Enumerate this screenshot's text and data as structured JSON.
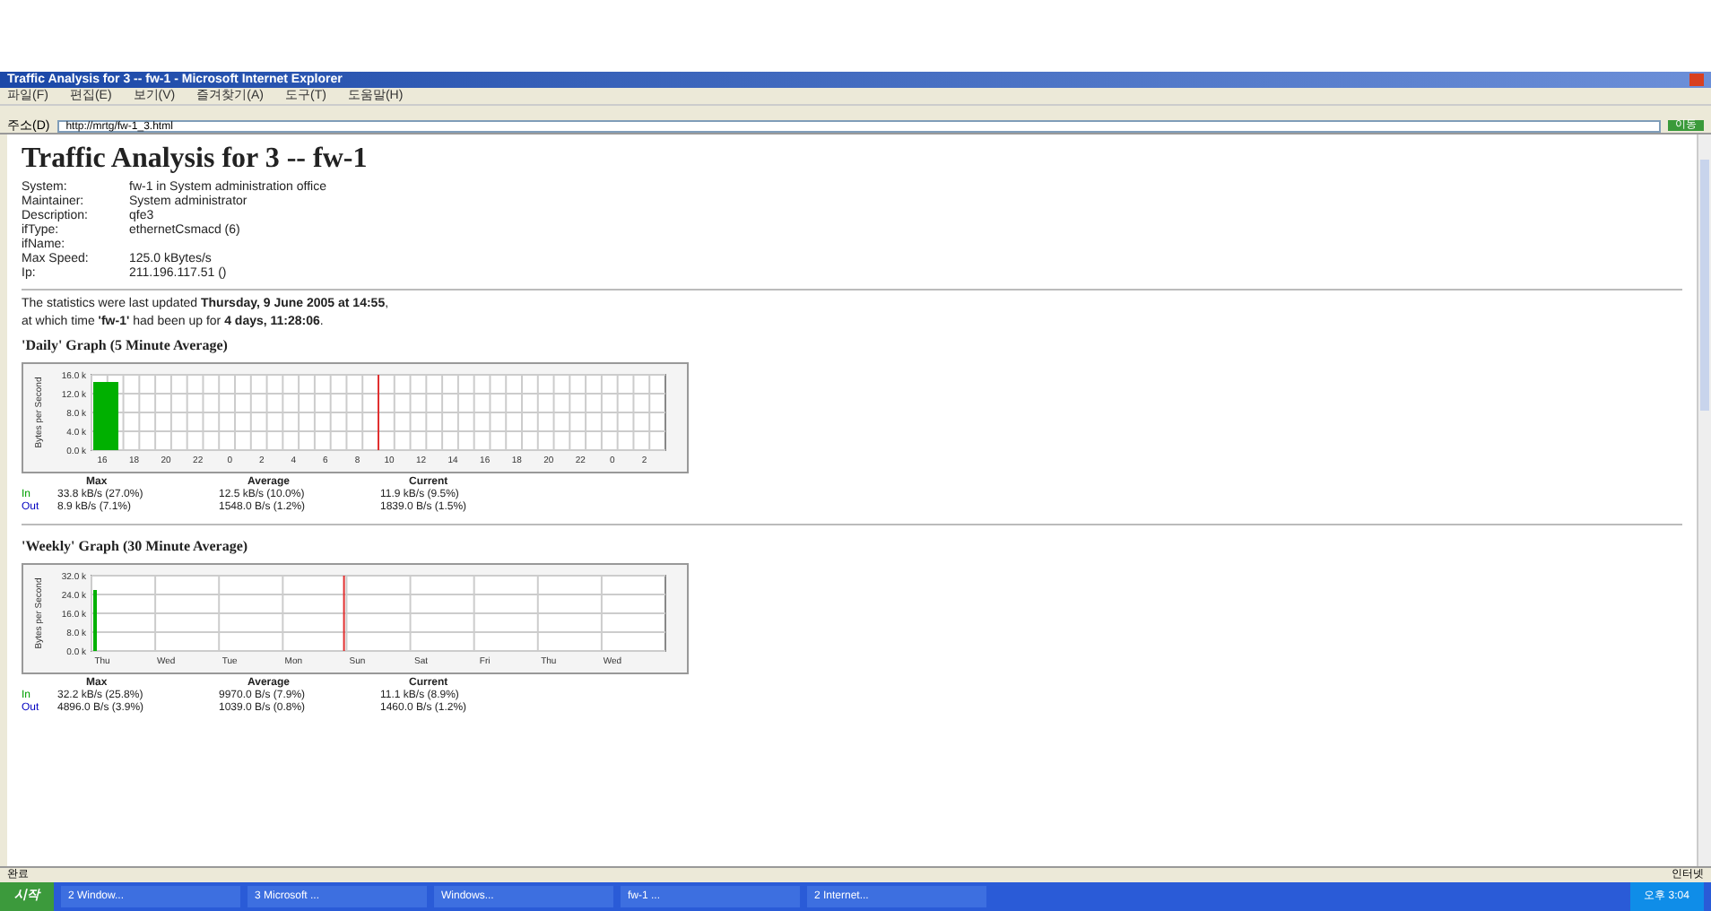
{
  "window": {
    "title": "Traffic Analysis for 3 -- fw-1 - Microsoft Internet Explorer"
  },
  "menu": [
    "파일(F)",
    "편집(E)",
    "보기(V)",
    "즐겨찾기(A)",
    "도구(T)",
    "도움말(H)"
  ],
  "address": {
    "label": "주소(D)",
    "value": "http://mrtg/fw-1_3.html",
    "go": "이동"
  },
  "page": {
    "heading": "Traffic Analysis for 3 -- fw-1",
    "info": [
      {
        "label": "System:",
        "value": "fw-1 in System administration office"
      },
      {
        "label": "Maintainer:",
        "value": "System administrator"
      },
      {
        "label": "Description:",
        "value": "qfe3"
      },
      {
        "label": "ifType:",
        "value": "ethernetCsmacd (6)"
      },
      {
        "label": "ifName:"
      },
      {
        "label": "Max Speed:",
        "value": "125.0 kBytes/s"
      },
      {
        "label": "Ip:",
        "value": "211.196.117.51 ()"
      }
    ],
    "updated": "The statistics were last updated **Thursday, 9 June 2005 at 14:55**,",
    "uptime": "at which time **'fw-1'** had been up for **4 days, 11:28:06**.",
    "graphs": [
      {
        "title": "'Daily' Graph (5 Minute Average)",
        "kind": "daily",
        "ylabel": "Bytes per Second",
        "columns": [
          "Max",
          "Average",
          "Current"
        ],
        "yticks": [
          "16.0 k",
          "12.0 k",
          "8.0 k",
          "4.0 k",
          "0.0 k"
        ],
        "xlabels": [
          "16",
          "18",
          "20",
          "22",
          "0",
          "2",
          "4",
          "6",
          "8",
          "10",
          "12",
          "14",
          "16",
          "18",
          "20",
          "22",
          "0",
          "2"
        ],
        "rows": [
          {
            "name": "In",
            "max": "33.8 kB/s (27.0%)",
            "average": "12.5 kB/s (10.0%)",
            "current": "11.9 kB/s (9.5%)"
          },
          {
            "name": "Out",
            "max": "8.9 kB/s (7.1%)",
            "average": "1548.0 B/s (1.2%)",
            "current": "1839.0 B/s (1.5%)"
          }
        ]
      },
      {
        "title": "'Weekly' Graph (30 Minute Average)",
        "kind": "weekly",
        "ylabel": "Bytes per Second",
        "columns": [
          "Max",
          "Average",
          "Current"
        ],
        "yticks": [
          "32.0 k",
          "24.0 k",
          "16.0 k",
          "8.0 k",
          "0.0 k"
        ],
        "xlabels": [
          "Thu",
          "Wed",
          "Tue",
          "Mon",
          "Sun",
          "Sat",
          "Fri",
          "Thu",
          "Wed"
        ],
        "rows": [
          {
            "name": "In",
            "max": "32.2 kB/s (25.8%)",
            "average": "9970.0 B/s (7.9%)",
            "current": "11.1 kB/s (8.9%)"
          },
          {
            "name": "Out",
            "max": "4896.0 B/s (3.9%)",
            "average": "1039.0 B/s (0.8%)",
            "current": "1460.0 B/s (1.2%)"
          }
        ]
      }
    ]
  },
  "status_bar": {
    "text": "완료",
    "zone": "인터넷"
  },
  "taskbar": {
    "start": "시작",
    "tasks": [
      "2 Window...",
      "3 Microsoft ...",
      "Windows...",
      "fw-1 ...",
      "2 Internet..."
    ],
    "clock": "오후 3:04"
  }
}
